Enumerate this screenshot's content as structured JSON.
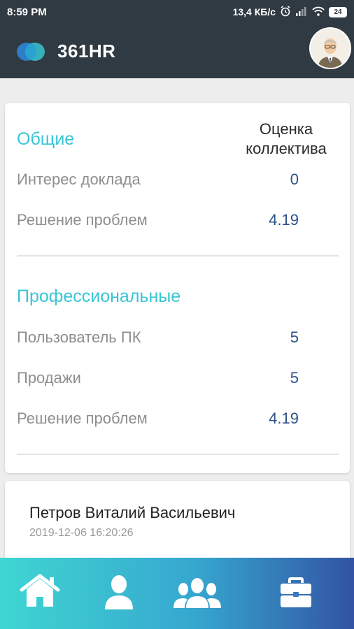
{
  "status_bar": {
    "time": "8:59 PM",
    "network_speed": "13,4 КБ/с",
    "battery_level": "24",
    "icons": [
      "alarm-icon",
      "signal-icon",
      "wifi-icon",
      "battery-icon"
    ]
  },
  "app_bar": {
    "brand": "361HR",
    "avatar_icon": "user-avatar",
    "colors": {
      "background": "#2f3a42",
      "accent": "#38c6d4",
      "value": "#2d4f8a"
    }
  },
  "ratings": {
    "column_header": "Оценка коллектива",
    "groups": [
      {
        "title": "Общие",
        "rows": [
          {
            "label": "Интерес доклада",
            "value": "0"
          },
          {
            "label": "Решение проблем",
            "value": "4.19"
          }
        ]
      },
      {
        "title": "Профессиональные",
        "rows": [
          {
            "label": "Пользователь ПК",
            "value": "5"
          },
          {
            "label": "Продажи",
            "value": "5"
          },
          {
            "label": "Решение проблем",
            "value": "4.19"
          }
        ]
      }
    ]
  },
  "review": {
    "name": "Петров Виталий Васильевич",
    "date": "2019-12-06 16:20:26"
  },
  "bottom_nav": {
    "items": [
      "home-icon",
      "person-icon",
      "group-icon",
      "briefcase-icon"
    ]
  }
}
